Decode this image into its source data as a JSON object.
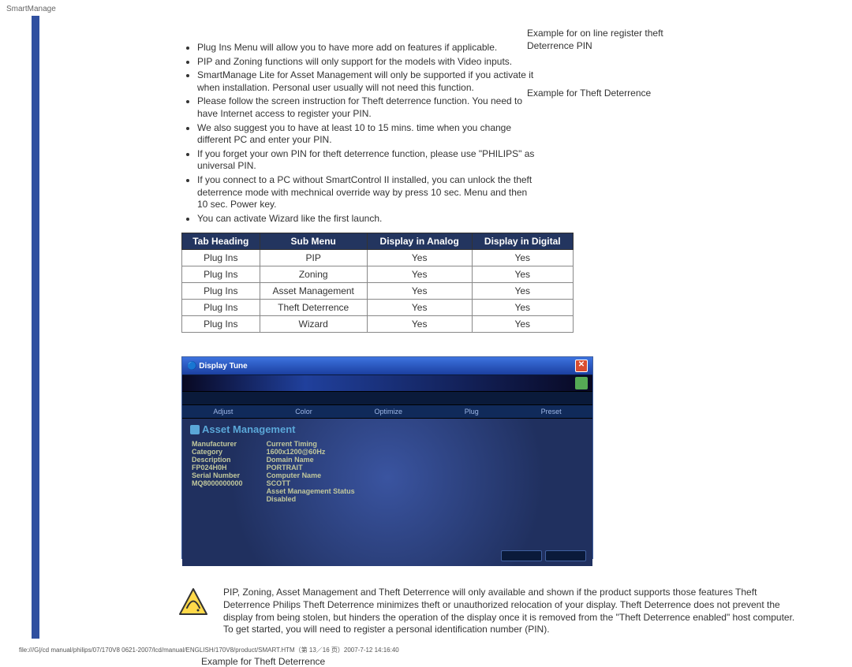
{
  "page_header": "SmartManage",
  "bullets": [
    "Plug Ins Menu will allow you to have more add on features if applicable.",
    "PIP and Zoning functions will only support for the models with Video inputs.",
    "SmartManage Lite for Asset Management will only be supported if you activate it when installation. Personal user usually will not need this function.",
    "Please follow the screen instruction for Theft deterrence function. You need to have Internet access to register your PIN.",
    "We also suggest you to have at least 10 to 15 mins. time when you change different PC and enter your PIN.",
    "If you forget your own PIN for theft deterrence function, please use \"PHILIPS\" as universal PIN.",
    "If you connect to a PC without SmartControl II installed, you can unlock the theft deterrence mode with mechnical override way by press 10 sec. Menu and then 10 sec. Power key.",
    "You can activate Wizard like the first launch."
  ],
  "examples": {
    "ex1": "Example for on line register theft Deterrence PIN",
    "ex2": "Example for Theft Deterrence"
  },
  "table": {
    "headers": [
      "Tab Heading",
      "Sub Menu",
      "Display in Analog",
      "Display in Digital"
    ],
    "rows": [
      [
        "Plug Ins",
        "PIP",
        "Yes",
        "Yes"
      ],
      [
        "Plug Ins",
        "Zoning",
        "Yes",
        "Yes"
      ],
      [
        "Plug Ins",
        "Asset Management",
        "Yes",
        "Yes"
      ],
      [
        "Plug Ins",
        "Theft Deterrence",
        "Yes",
        "Yes"
      ],
      [
        "Plug Ins",
        "Wizard",
        "Yes",
        "Yes"
      ]
    ]
  },
  "screenshot": {
    "title": "Display Tune",
    "tabs": [
      "Adjust",
      "Color",
      "Optimize",
      "Plug",
      "Preset"
    ],
    "panel_title": "Asset Management",
    "labels_left": [
      "Manufacturer",
      "Category",
      "Description",
      "FP024H0H",
      "Serial Number",
      "MQ8000000000"
    ],
    "labels_right": [
      "Current Timing",
      "1600x1200@60Hz",
      "Domain Name",
      "PORTRAIT",
      "Computer Name",
      "SCOTT",
      "Asset Management Status",
      "Disabled"
    ]
  },
  "note": "PIP, Zoning, Asset Management and Theft Deterrence will only available and shown if the product supports those features Theft Deterrence Philips Theft Deterrence minimizes theft or unauthorized relocation of your display. Theft Deterrence does not prevent the display from being stolen, but hinders the operation of the display once it is removed from the \"Theft Deterrence enabled\" host computer. To get started, you will need to register a personal identification number (PIN).",
  "example_below": "Example for Theft Deterrence",
  "footer": "file:///G|/cd manual/philips/07/170V8 0621-2007/lcd/manual/ENGLISH/170V8/product/SMART.HTM（第 13／16 页）2007-7-12 14:16:40"
}
